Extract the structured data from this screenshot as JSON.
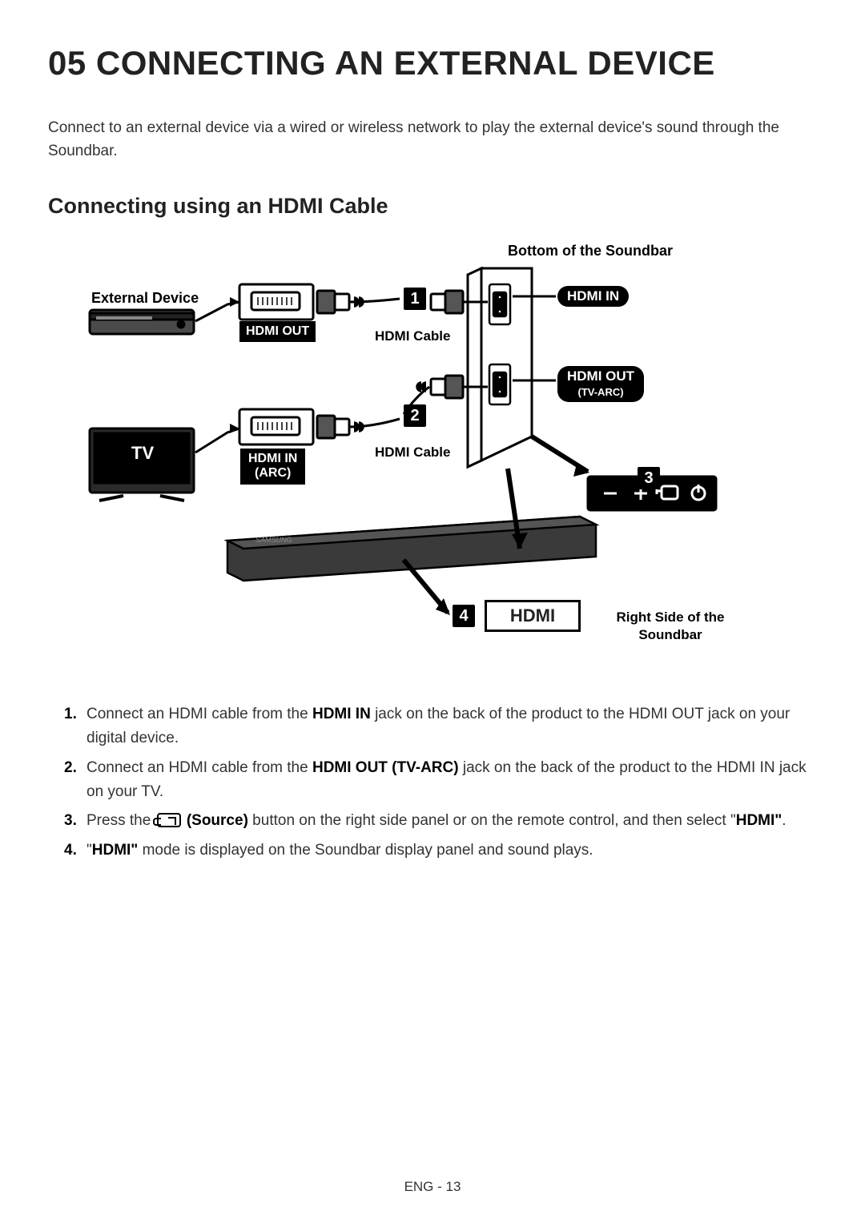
{
  "heading": "05   CONNECTING AN EXTERNAL DEVICE",
  "intro": "Connect to an external device via a wired or wireless network to play the external device's sound through the Soundbar.",
  "subheading": "Connecting using an HDMI Cable",
  "diagram": {
    "bottom_label": "Bottom of the Soundbar",
    "external_device": "External Device",
    "hdmi_out_ext": "HDMI OUT",
    "hdmi_cable_1": "HDMI Cable",
    "hdmi_cable_2": "HDMI Cable",
    "hdmi_in_sb": "HDMI IN",
    "hdmi_out_sb_line1": "HDMI OUT",
    "hdmi_out_sb_line2": "(TV-ARC)",
    "tv": "TV",
    "hdmi_in_tv_line1": "HDMI IN",
    "hdmi_in_tv_line2": "(ARC)",
    "rightside_line1": "Right Side of the",
    "rightside_line2": "Soundbar",
    "display_text": "HDMI",
    "badge_1": "1",
    "badge_2": "2",
    "badge_3": "3",
    "badge_4": "4"
  },
  "steps": {
    "s1_a": "Connect an HDMI cable from the ",
    "s1_b": "HDMI IN",
    "s1_c": " jack on the back of the product to the HDMI OUT jack on your digital device.",
    "s2_a": "Connect an HDMI cable from the ",
    "s2_b": "HDMI OUT (TV-ARC)",
    "s2_c": " jack on the back of the product to the HDMI IN jack on your TV.",
    "s3_a": "Press the ",
    "s3_b": "(Source)",
    "s3_c": " button on the right side panel or on the remote control, and then select \"",
    "s3_d": "HDMI\"",
    "s3_e": ".",
    "s4_a": "\"",
    "s4_b": "HDMI\"",
    "s4_c": " mode is displayed on the Soundbar display panel and sound plays."
  },
  "footer": "ENG - 13"
}
